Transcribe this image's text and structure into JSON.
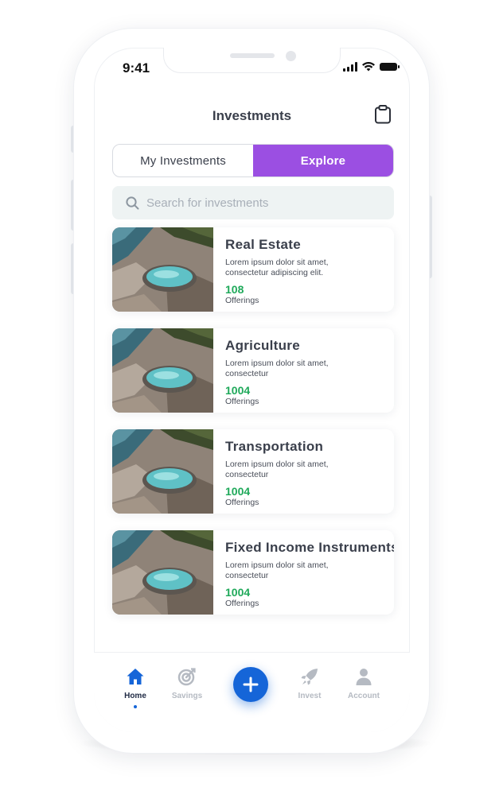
{
  "status_bar": {
    "time": "9:41"
  },
  "header": {
    "title": "Investments",
    "clipboard_icon": "clipboard-icon"
  },
  "tabs": [
    {
      "label": "My Investments",
      "active": false
    },
    {
      "label": "Explore",
      "active": true
    }
  ],
  "search": {
    "placeholder": "Search for investments",
    "icon": "search-icon"
  },
  "investments": [
    {
      "title": "Real Estate",
      "description": "Lorem ipsum dolor sit amet, consectetur adipiscing elit.",
      "count": "108",
      "unit": "Offerings"
    },
    {
      "title": "Agriculture",
      "description": "Lorem ipsum dolor sit amet, consectetur",
      "count": "1004",
      "unit": "Offerings"
    },
    {
      "title": "Transportation",
      "description": "Lorem ipsum dolor sit amet, consectetur",
      "count": "1004",
      "unit": "Offerings"
    },
    {
      "title": "Fixed Income Instruments",
      "description": "Lorem ipsum dolor sit amet, consectetur",
      "count": "1004",
      "unit": "Offerings"
    }
  ],
  "bottom_nav": {
    "items": [
      {
        "label": "Home",
        "icon": "home-icon",
        "active": true
      },
      {
        "label": "Savings",
        "icon": "target-icon",
        "active": false
      },
      {
        "label": "Invest",
        "icon": "rocket-icon",
        "active": false
      },
      {
        "label": "Account",
        "icon": "user-icon",
        "active": false
      }
    ],
    "fab_icon": "plus-icon"
  },
  "colors": {
    "accent_purple": "#9b4fe2",
    "primary_blue": "#1565d8",
    "count_green": "#1fa95a",
    "search_bg": "#eef3f3"
  }
}
